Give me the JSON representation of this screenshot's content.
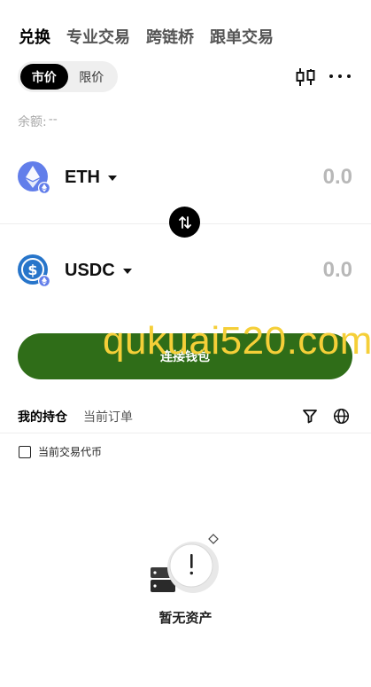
{
  "header": {
    "tabs": [
      {
        "label": "兑换",
        "active": true
      },
      {
        "label": "专业交易",
        "active": false
      },
      {
        "label": "跨链桥",
        "active": false
      },
      {
        "label": "跟单交易",
        "active": false
      }
    ]
  },
  "order_type": {
    "options": [
      {
        "label": "市价",
        "active": true
      },
      {
        "label": "限价",
        "active": false
      }
    ]
  },
  "toolbar": {
    "chart_icon": "candlestick-chart-icon",
    "more_icon": "more-dots-icon"
  },
  "balance": {
    "label": "余额:",
    "value": "--"
  },
  "from_token": {
    "symbol": "ETH",
    "amount": "0.0",
    "icon": "ethereum-icon",
    "network_badge": "ethereum-network-badge",
    "color": "#627eea"
  },
  "to_token": {
    "symbol": "USDC",
    "amount": "0.0",
    "icon": "usdc-icon",
    "network_badge": "ethereum-network-badge",
    "color": "#2775ca"
  },
  "swap_icon": "swap-direction-icon",
  "connect_button": {
    "label": "连接钱包",
    "color": "#2f6d18"
  },
  "watermark": {
    "text": "qukuai520.com",
    "color": "#f5cf38"
  },
  "holdings": {
    "tabs": [
      {
        "label": "我的持仓",
        "active": true
      },
      {
        "label": "当前订单",
        "active": false
      }
    ],
    "filter_icon": "filter-icon",
    "network_icon": "globe-icon",
    "checkbox_label": "当前交易代币",
    "checkbox_checked": false,
    "empty_text": "暂无资产",
    "empty_icon": "empty-assets-icon"
  }
}
